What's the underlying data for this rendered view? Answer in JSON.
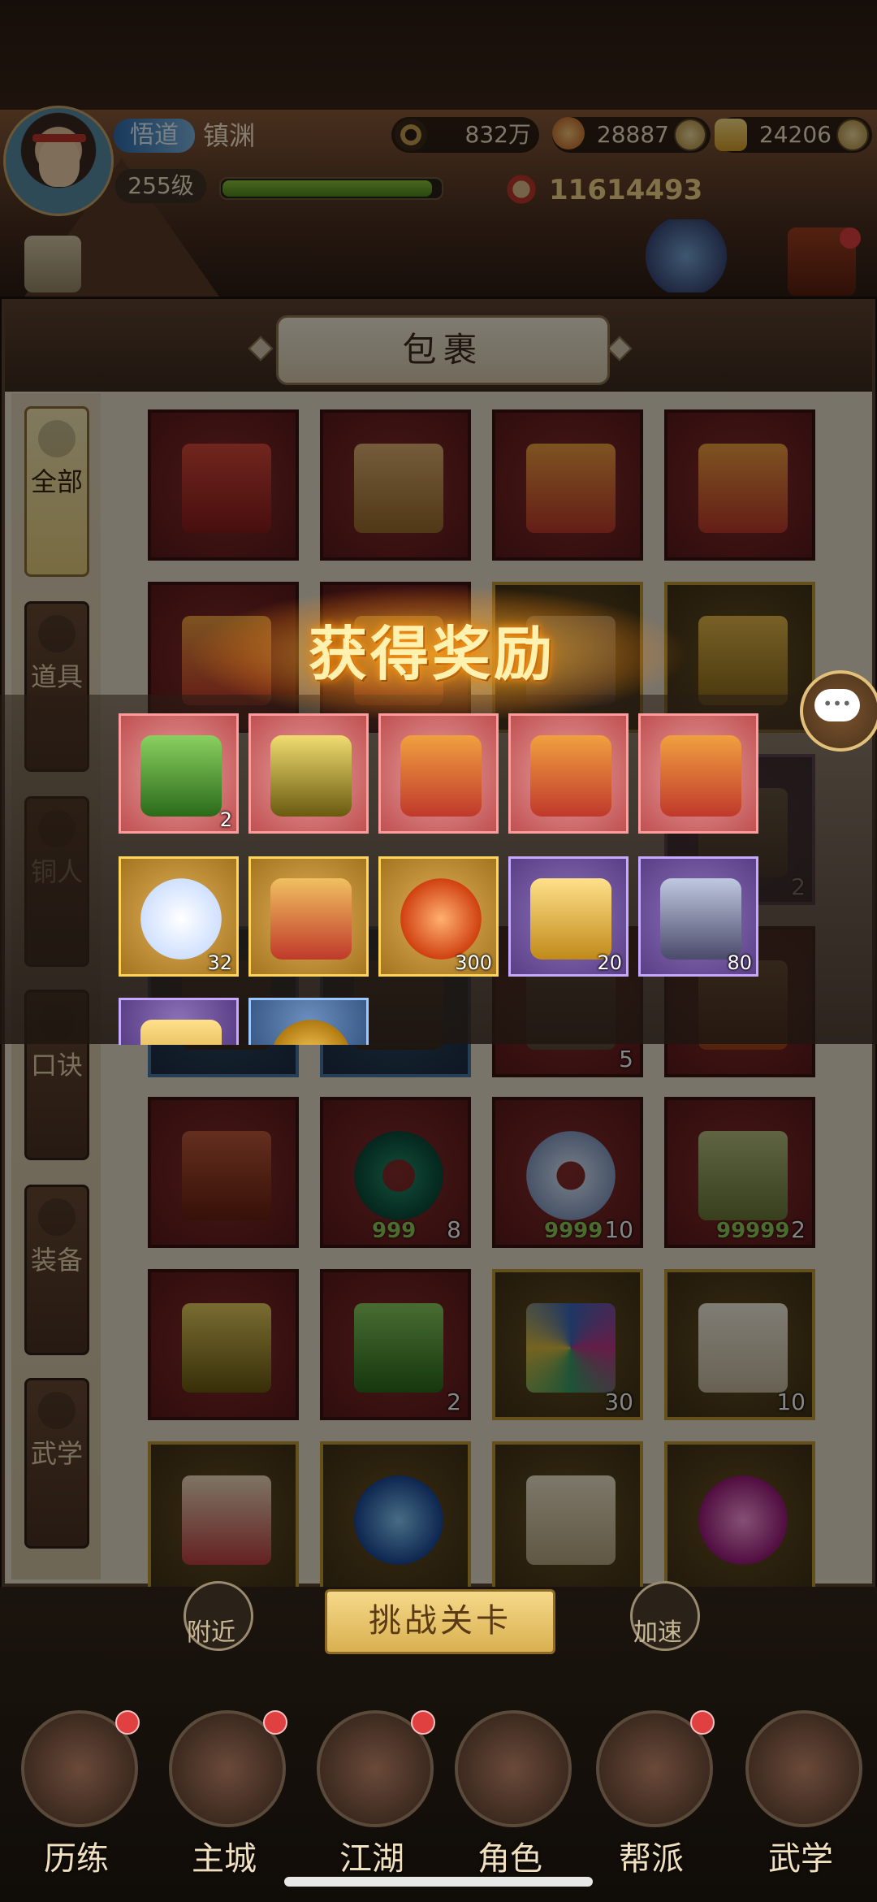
{
  "header": {
    "rank_badge": "悟道",
    "player_name": "镇渊",
    "level": "255级",
    "exp_fraction": 0.95,
    "currency_coins": "832万",
    "currency_vouchers": "28887",
    "currency_gold": "24206",
    "power": "11614493"
  },
  "bag": {
    "title": "包裹",
    "tabs": [
      {
        "label": "全部",
        "active": true
      },
      {
        "label": "道具"
      },
      {
        "label": "铜人"
      },
      {
        "label": "口诀"
      },
      {
        "label": "装备"
      },
      {
        "label": "武学"
      }
    ],
    "items": [
      {
        "rarity": "red",
        "icon": "red-envelope-pack-icon",
        "count": ""
      },
      {
        "rarity": "red",
        "icon": "ultimate-gift-box-icon",
        "count": ""
      },
      {
        "rarity": "red",
        "icon": "festive-gift-box-icon",
        "count": ""
      },
      {
        "rarity": "red",
        "icon": "festive-gift-box-icon",
        "count": ""
      },
      {
        "rarity": "red",
        "icon": "festive-gift-box-icon",
        "count": ""
      },
      {
        "rarity": "red",
        "icon": "gift-box-icon",
        "count": ""
      },
      {
        "rarity": "gold",
        "icon": "arrows-icon",
        "count": ""
      },
      {
        "rarity": "gold",
        "icon": "wrapped-gift-icon",
        "count": ""
      },
      {
        "rarity": "gold",
        "icon": "item-icon",
        "count": "",
        "hidden": true
      },
      {
        "rarity": "gold",
        "icon": "item-icon",
        "count": "",
        "hidden": true
      },
      {
        "rarity": "gold",
        "icon": "item-icon",
        "count": "",
        "hidden": true
      },
      {
        "rarity": "purple",
        "icon": "arrows-icon",
        "count": "2"
      },
      {
        "rarity": "blue",
        "icon": "item-icon",
        "count": ""
      },
      {
        "rarity": "blue",
        "icon": "item-icon",
        "count": ""
      },
      {
        "rarity": "red",
        "icon": "arrows-icon",
        "count": "5"
      },
      {
        "rarity": "red",
        "icon": "token-icon",
        "count": ""
      },
      {
        "rarity": "red",
        "icon": "snake-icon",
        "count": ""
      },
      {
        "rarity": "red",
        "icon": "jade-ring-icon",
        "count": "8",
        "limit": "999"
      },
      {
        "rarity": "red",
        "icon": "cloud-ring-icon",
        "count": "10",
        "limit": "9999"
      },
      {
        "rarity": "red",
        "icon": "jade-tablet-icon",
        "count": "2",
        "limit": "99999"
      },
      {
        "rarity": "red",
        "icon": "gold-stone-shi-icon",
        "count": ""
      },
      {
        "rarity": "red",
        "icon": "green-stone-wu-icon",
        "count": "2"
      },
      {
        "rarity": "gold",
        "icon": "pinwheel-icon",
        "count": "30"
      },
      {
        "rarity": "gold",
        "icon": "qianji-talisman-icon",
        "count": "10"
      },
      {
        "rarity": "gold",
        "icon": "qianji-scroll-icon",
        "count": ""
      },
      {
        "rarity": "gold",
        "icon": "blue-orb-icon",
        "count": ""
      },
      {
        "rarity": "gold",
        "icon": "scroll-icon",
        "count": ""
      },
      {
        "rarity": "gold",
        "icon": "pink-orb-icon",
        "count": ""
      }
    ]
  },
  "reward": {
    "title": "获得奖励",
    "items": [
      {
        "rarity": "red",
        "icon": "green-stone-wu-icon",
        "count": "2"
      },
      {
        "rarity": "red",
        "icon": "gold-stone-shi-icon",
        "count": ""
      },
      {
        "rarity": "red",
        "icon": "festive-gift-box-icon",
        "count": ""
      },
      {
        "rarity": "red",
        "icon": "festive-gift-box-icon",
        "count": ""
      },
      {
        "rarity": "red",
        "icon": "festive-gift-box-icon",
        "count": ""
      },
      {
        "rarity": "gold",
        "icon": "mochi-icon",
        "count": "32"
      },
      {
        "rarity": "gold",
        "icon": "book-chest-icon",
        "count": ""
      },
      {
        "rarity": "gold",
        "icon": "red-orb-icon",
        "count": "300"
      },
      {
        "rarity": "purple",
        "icon": "gold-nugget-icon",
        "count": "20"
      },
      {
        "rarity": "purple",
        "icon": "iron-ore-icon",
        "count": "80"
      },
      {
        "rarity": "purple",
        "icon": "gold-crystal-icon",
        "count": ""
      },
      {
        "rarity": "blue",
        "icon": "gold-coin-icon",
        "count": ""
      }
    ]
  },
  "bottom": {
    "challenge_button": "挑战关卡",
    "nearby": "附近",
    "speedup": "加速",
    "nav": [
      "历练",
      "主城",
      "江湖",
      "角色",
      "帮派",
      "武学"
    ]
  },
  "colors": {
    "red_slot": "#7a2626",
    "gold_slot": "#bf9a35",
    "purple_slot": "#7a5a94",
    "blue_slot": "#4a7aa8",
    "accent": "#f5d98a"
  }
}
